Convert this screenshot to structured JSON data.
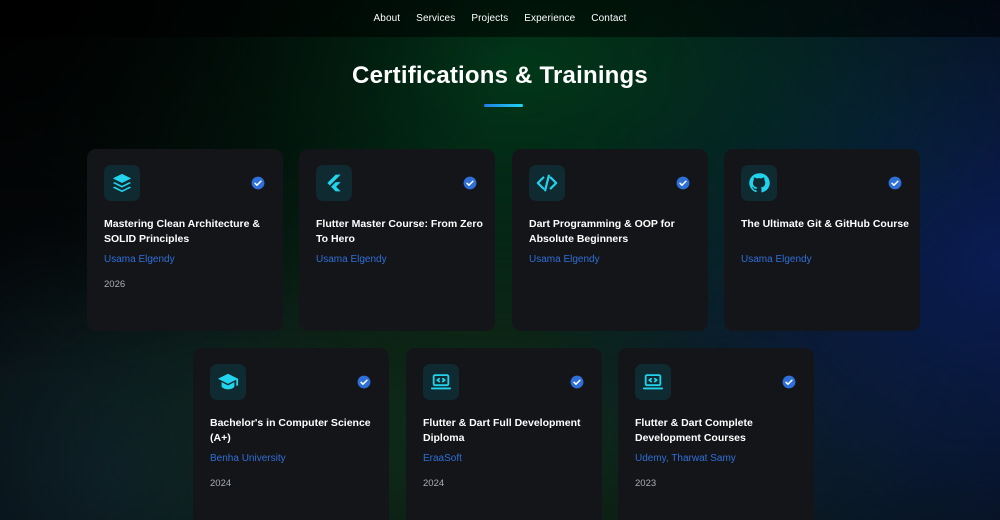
{
  "nav": {
    "items": [
      "About",
      "Services",
      "Projects",
      "Experience",
      "Contact"
    ]
  },
  "section": {
    "title": "Certifications & Trainings"
  },
  "colors": {
    "accent": "#22d3ee",
    "link_blue": "#2f6fd8",
    "card_bg": "#141519",
    "icon_bg": "#0f2a30"
  },
  "cards": [
    {
      "icon": "layers-icon",
      "title": "Mastering Clean Architecture & SOLID Principles",
      "issuer": "Usama Elgendy",
      "year": "2026"
    },
    {
      "icon": "flutter-icon",
      "title": "Flutter Master Course: From Zero To Hero",
      "issuer": "Usama Elgendy",
      "year": ""
    },
    {
      "icon": "code-icon",
      "title": "Dart Programming & OOP for Absolute Beginners",
      "issuer": "Usama Elgendy",
      "year": ""
    },
    {
      "icon": "github-icon",
      "title": "The Ultimate Git & GitHub Course",
      "issuer": "Usama Elgendy",
      "year": ""
    },
    {
      "icon": "graduation-cap-icon",
      "title": "Bachelor's in Computer Science (A+)",
      "issuer": "Benha University",
      "year": "2024"
    },
    {
      "icon": "laptop-code-icon",
      "title": "Flutter & Dart Full Development Diploma",
      "issuer": "EraaSoft",
      "year": "2024"
    },
    {
      "icon": "laptop-code-icon",
      "title": "Flutter & Dart Complete Development Courses",
      "issuer": "Udemy, Tharwat Samy",
      "year": "2023"
    }
  ]
}
